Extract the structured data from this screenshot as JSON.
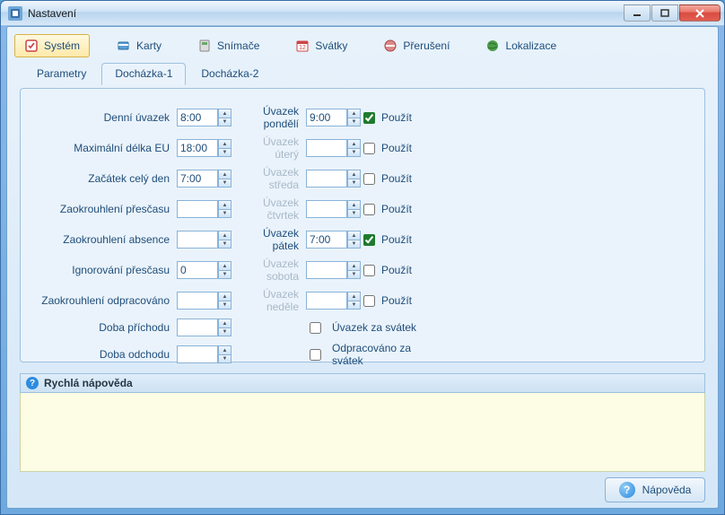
{
  "window": {
    "title": "Nastavení"
  },
  "toolbar": [
    {
      "id": "system",
      "label": "Systém",
      "active": true
    },
    {
      "id": "karty",
      "label": "Karty",
      "active": false
    },
    {
      "id": "snimace",
      "label": "Snímače",
      "active": false
    },
    {
      "id": "svatky",
      "label": "Svátky",
      "active": false
    },
    {
      "id": "preruseni",
      "label": "Přerušení",
      "active": false
    },
    {
      "id": "lokalizace",
      "label": "Lokalizace",
      "active": false
    }
  ],
  "tabs": [
    {
      "id": "parametry",
      "label": "Parametry",
      "active": false
    },
    {
      "id": "dochazka1",
      "label": "Docházka-1",
      "active": true
    },
    {
      "id": "dochazka2",
      "label": "Docházka-2",
      "active": false
    }
  ],
  "left_rows": [
    {
      "label": "Denní úvazek",
      "value": "8:00"
    },
    {
      "label": "Maximální délka EU",
      "value": "18:00"
    },
    {
      "label": "Začátek celý den",
      "value": "7:00"
    },
    {
      "label": "Zaokrouhlení přesčasu",
      "value": ""
    },
    {
      "label": "Zaokrouhlení absence",
      "value": ""
    },
    {
      "label": "Ignorování přesčasu",
      "value": "0"
    },
    {
      "label": "Zaokrouhlení odpracováno",
      "value": ""
    },
    {
      "label": "Doba příchodu",
      "value": ""
    },
    {
      "label": "Doba odchodu",
      "value": ""
    }
  ],
  "right_rows": [
    {
      "label": "Úvazek pondělí",
      "value": "9:00",
      "enabled": true,
      "checked": true
    },
    {
      "label": "Úvazek úterý",
      "value": "",
      "enabled": false,
      "checked": false
    },
    {
      "label": "Úvazek středa",
      "value": "",
      "enabled": false,
      "checked": false
    },
    {
      "label": "Úvazek čtvrtek",
      "value": "",
      "enabled": false,
      "checked": false
    },
    {
      "label": "Úvazek pátek",
      "value": "7:00",
      "enabled": true,
      "checked": true
    },
    {
      "label": "Úvazek sobota",
      "value": "",
      "enabled": false,
      "checked": false
    },
    {
      "label": "Úvazek neděle",
      "value": "",
      "enabled": false,
      "checked": false
    }
  ],
  "use_label": "Použít",
  "extra_checks": [
    {
      "label": "Úvazek za svátek",
      "checked": false
    },
    {
      "label": "Odpracováno za svátek",
      "checked": false
    }
  ],
  "help": {
    "title": "Rychlá nápověda",
    "button": "Nápověda"
  }
}
